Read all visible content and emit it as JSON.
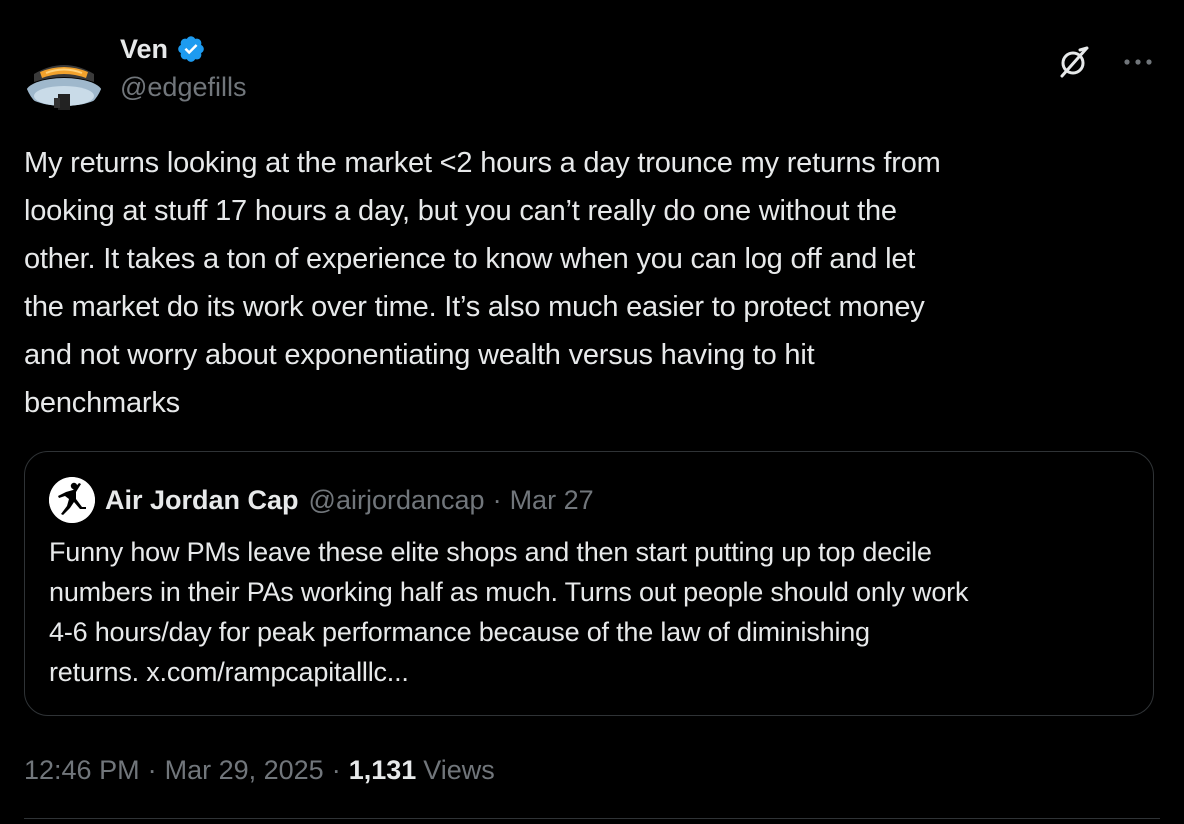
{
  "author": {
    "display_name": "Ven",
    "handle": "@edgefills",
    "verified": true,
    "verified_color": "#1d9bf0"
  },
  "actions": {
    "grok_icon": "grok-icon",
    "more_icon": "more-icon"
  },
  "tweet": {
    "text": "My returns looking at the market <2 hours a day trounce my returns from\nlooking at stuff 17 hours a day, but you can’t really do one without the\nother. It takes a ton of experience to know when you can log off and let\nthe market do its work over time. It’s also much easier to protect money\nand not worry about exponentiating wealth versus having to hit\nbenchmarks"
  },
  "quote": {
    "display_name": "Air Jordan Cap",
    "handle": "@airjordancap",
    "separator": "·",
    "date": "Mar 27",
    "text": "Funny how PMs leave these elite shops and then start putting up top decile\nnumbers in their PAs working half as much. Turns out people should only work\n4-6 hours/day for peak performance because of the law of diminishing\nreturns. x.com/rampcapitalllc..."
  },
  "meta": {
    "time": "12:46 PM",
    "separator": "·",
    "date": "Mar 29, 2025",
    "views_count": "1,131",
    "views_label": "Views"
  },
  "colors": {
    "background": "#000000",
    "text_primary": "#e7e9ea",
    "text_secondary": "#71767b",
    "border": "#2f3336"
  }
}
